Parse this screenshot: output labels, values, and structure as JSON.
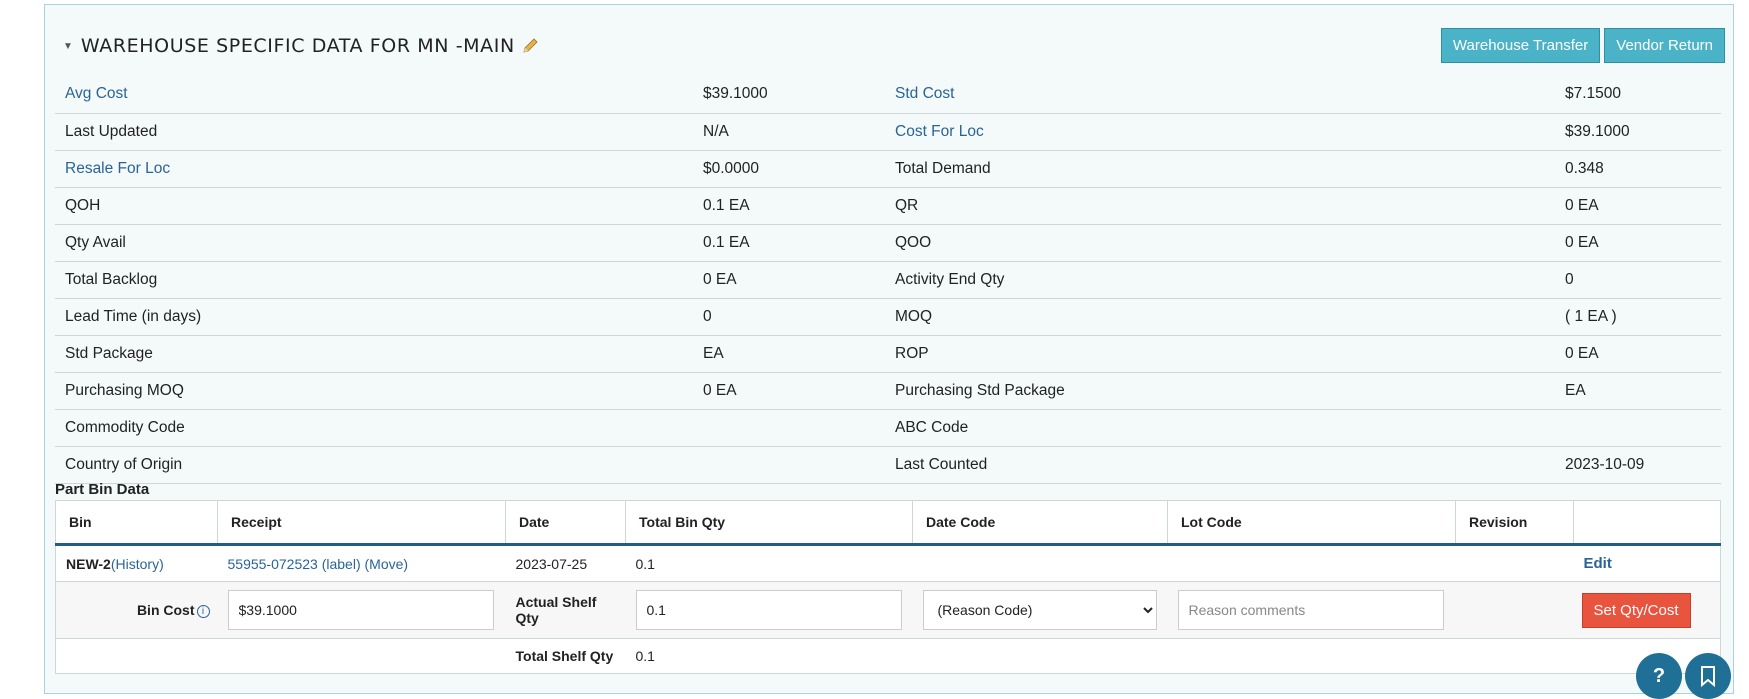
{
  "section": {
    "title": "WAREHOUSE SPECIFIC DATA FOR MN -MAIN",
    "buttons": {
      "warehouse_transfer": "Warehouse Transfer",
      "vendor_return": "Vendor Return"
    }
  },
  "rows": [
    {
      "l_label": "Avg Cost",
      "l_value": "$39.1000",
      "r_label": "Std Cost",
      "r_value": "$7.1500"
    },
    {
      "l_label": "Last Updated",
      "l_value": "N/A",
      "r_label": "Cost For Loc",
      "r_value": "$39.1000"
    },
    {
      "l_label": "Resale For Loc",
      "l_value": "$0.0000",
      "r_label": "Total Demand",
      "r_value": "0.348"
    },
    {
      "l_label": "QOH",
      "l_value": "0.1 EA",
      "r_label": "QR",
      "r_value": "0 EA"
    },
    {
      "l_label": "Qty Avail",
      "l_value": "0.1 EA",
      "r_label": "QOO",
      "r_value": "0 EA"
    },
    {
      "l_label": "Total Backlog",
      "l_value": "0 EA",
      "r_label": "Activity End Qty",
      "r_value": "0"
    },
    {
      "l_label": "Lead Time (in days)",
      "l_value": "0",
      "r_label": "MOQ",
      "r_value": "( 1 EA )"
    },
    {
      "l_label": "Std Package",
      "l_value": "EA",
      "r_label": "ROP",
      "r_value": "0 EA"
    },
    {
      "l_label": "Purchasing MOQ",
      "l_value": "0 EA",
      "r_label": "Purchasing Std Package",
      "r_value": "EA"
    },
    {
      "l_label": "Commodity Code",
      "l_value": "",
      "r_label": "ABC Code",
      "r_value": ""
    },
    {
      "l_label": "Country of Origin",
      "l_value": "",
      "r_label": "Last Counted",
      "r_value": "2023-10-09"
    }
  ],
  "bin_data": {
    "title": "Part Bin Data",
    "headers": [
      "Bin",
      "Receipt",
      "Date",
      "Total Bin Qty",
      "Date Code",
      "Lot Code",
      "Revision",
      ""
    ],
    "row": {
      "bin": "NEW-2",
      "history": "(History)",
      "receipt": "55955-072523",
      "label": "(label)",
      "move": "(Move)",
      "date": "2023-07-25",
      "total_bin_qty": "0.1",
      "edit": "Edit"
    },
    "edit_row": {
      "bin_cost_label": "Bin Cost",
      "bin_cost_value": "$39.1000",
      "actual_shelf_label": "Actual Shelf Qty",
      "actual_shelf_value": "0.1",
      "reason_selected": "(Reason Code)",
      "reason_placeholder": "Reason comments",
      "set_button": "Set Qty/Cost"
    },
    "total_row": {
      "label": "Total Shelf Qty",
      "value": "0.1"
    }
  },
  "fab": {
    "help": "?"
  }
}
